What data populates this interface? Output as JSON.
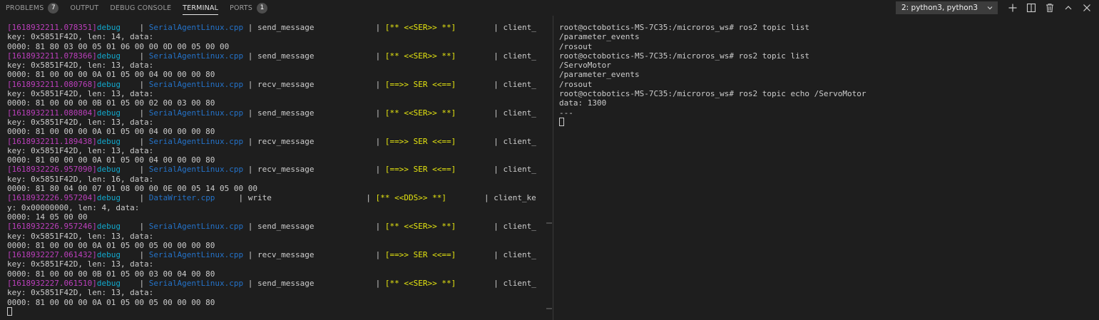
{
  "panel_tabs": [
    {
      "label": "PROBLEMS",
      "badge": "7",
      "active": false
    },
    {
      "label": "OUTPUT",
      "badge": "",
      "active": false
    },
    {
      "label": "DEBUG CONSOLE",
      "badge": "",
      "active": false
    },
    {
      "label": "TERMINAL",
      "badge": "",
      "active": true
    },
    {
      "label": "PORTS",
      "badge": "1",
      "active": false
    }
  ],
  "terminal_select": {
    "value": "2: python3, python3"
  },
  "toolbar": [
    {
      "icon": "add-icon"
    },
    {
      "icon": "split-icon"
    },
    {
      "icon": "trash-icon"
    },
    {
      "icon": "chevron-up-icon"
    },
    {
      "icon": "close-icon"
    }
  ],
  "left_terminal": {
    "entries": [
      {
        "ts": "[1618932211.078351]",
        "level": "debug",
        "sep1": "    | ",
        "file": "SerialAgentLinux.cpp",
        "sep2": " | ",
        "func": "send_message             ",
        "sep3": "| ",
        "tag": "[** <<SER>> **]",
        "sep4": "        | ",
        "tail": "client_",
        "wrap": "key: 0x5851F42D, len: 14, data:",
        "hex": "0000: 81 80 03 00 05 01 06 00 00 0D 00 05 00 00"
      },
      {
        "ts": "[1618932211.078366]",
        "level": "debug",
        "sep1": "    | ",
        "file": "SerialAgentLinux.cpp",
        "sep2": " | ",
        "func": "send_message             ",
        "sep3": "| ",
        "tag": "[** <<SER>> **]",
        "sep4": "        | ",
        "tail": "client_",
        "wrap": "key: 0x5851F42D, len: 13, data:",
        "hex": "0000: 81 00 00 00 0A 01 05 00 04 00 00 00 80"
      },
      {
        "ts": "[1618932211.080768]",
        "level": "debug",
        "sep1": "    | ",
        "file": "SerialAgentLinux.cpp",
        "sep2": " | ",
        "func": "recv_message             ",
        "sep3": "| ",
        "tag": "[==>> SER <<==]",
        "sep4": "        | ",
        "tail": "client_",
        "wrap": "key: 0x5851F42D, len: 13, data:",
        "hex": "0000: 81 00 00 00 0B 01 05 00 02 00 03 00 80"
      },
      {
        "ts": "[1618932211.080804]",
        "level": "debug",
        "sep1": "    | ",
        "file": "SerialAgentLinux.cpp",
        "sep2": " | ",
        "func": "send_message             ",
        "sep3": "| ",
        "tag": "[** <<SER>> **]",
        "sep4": "        | ",
        "tail": "client_",
        "wrap": "key: 0x5851F42D, len: 13, data:",
        "hex": "0000: 81 00 00 00 0A 01 05 00 04 00 00 00 80"
      },
      {
        "ts": "[1618932211.189438]",
        "level": "debug",
        "sep1": "    | ",
        "file": "SerialAgentLinux.cpp",
        "sep2": " | ",
        "func": "recv_message             ",
        "sep3": "| ",
        "tag": "[==>> SER <<==]",
        "sep4": "        | ",
        "tail": "client_",
        "wrap": "key: 0x5851F42D, len: 13, data:",
        "hex": "0000: 81 00 00 00 0A 01 05 00 04 00 00 00 80"
      },
      {
        "ts": "[1618932226.957090]",
        "level": "debug",
        "sep1": "    | ",
        "file": "SerialAgentLinux.cpp",
        "sep2": " | ",
        "func": "recv_message             ",
        "sep3": "| ",
        "tag": "[==>> SER <<==]",
        "sep4": "        | ",
        "tail": "client_",
        "wrap": "key: 0x5851F42D, len: 16, data:",
        "hex": "0000: 81 80 04 00 07 01 08 00 00 0E 00 05 14 05 00 00"
      },
      {
        "ts": "[1618932226.957204]",
        "level": "debug",
        "sep1": "    | ",
        "file": "DataWriter.cpp",
        "sep2": "     | ",
        "func": "write                    ",
        "sep3": "| ",
        "tag": "[** <<DDS>> **]",
        "sep4": "        | ",
        "tail": "client_ke",
        "wrap": "y: 0x00000000, len: 4, data:",
        "hex": "0000: 14 05 00 00"
      },
      {
        "ts": "[1618932226.957246]",
        "level": "debug",
        "sep1": "    | ",
        "file": "SerialAgentLinux.cpp",
        "sep2": " | ",
        "func": "send_message             ",
        "sep3": "| ",
        "tag": "[** <<SER>> **]",
        "sep4": "        | ",
        "tail": "client_",
        "wrap": "key: 0x5851F42D, len: 13, data:",
        "hex": "0000: 81 00 00 00 0A 01 05 00 05 00 00 00 80"
      },
      {
        "ts": "[1618932227.061432]",
        "level": "debug",
        "sep1": "    | ",
        "file": "SerialAgentLinux.cpp",
        "sep2": " | ",
        "func": "recv_message             ",
        "sep3": "| ",
        "tag": "[==>> SER <<==]",
        "sep4": "        | ",
        "tail": "client_",
        "wrap": "key: 0x5851F42D, len: 13, data:",
        "hex": "0000: 81 00 00 00 0B 01 05 00 03 00 04 00 80"
      },
      {
        "ts": "[1618932227.061510]",
        "level": "debug",
        "sep1": "    | ",
        "file": "SerialAgentLinux.cpp",
        "sep2": " | ",
        "func": "send_message             ",
        "sep3": "| ",
        "tag": "[** <<SER>> **]",
        "sep4": "        | ",
        "tail": "client_",
        "wrap": "key: 0x5851F42D, len: 13, data:",
        "hex": "0000: 81 00 00 00 0A 01 05 00 05 00 00 00 80"
      }
    ]
  },
  "right_terminal": {
    "lines": [
      "root@octobotics-MS-7C35:/microros_ws# ros2 topic list",
      "/parameter_events",
      "/rosout",
      "root@octobotics-MS-7C35:/microros_ws# ros2 topic list",
      "/ServoMotor",
      "/parameter_events",
      "/rosout",
      "root@octobotics-MS-7C35:/microros_ws# ros2 topic echo /ServoMotor",
      "data: 1300",
      "---"
    ]
  },
  "colors": {
    "background": "#1e1e1e",
    "timestamp": "#bc3fbc",
    "level": "#11a8cd",
    "file": "#2472c8",
    "tag": "#e5e510",
    "text": "#cccccc"
  }
}
